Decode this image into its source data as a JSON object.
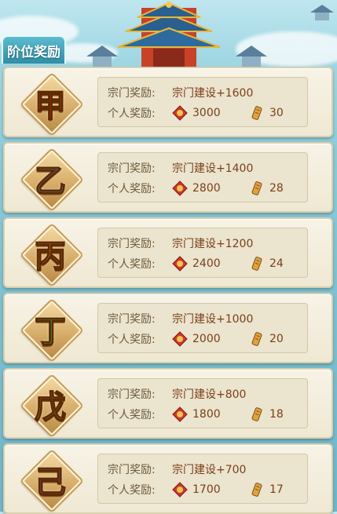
{
  "tab_label": "阶位奖励",
  "colors": {
    "card_bg": "#f2ecda",
    "label": "#6b5a3c",
    "value": "#7a3e18"
  },
  "icons": {
    "currency_1": "gem-coin-icon",
    "currency_2": "scroll-icon"
  },
  "rewards": [
    {
      "rank": "甲",
      "rank_color": "#e8361b",
      "sect_label": "宗门奖励:",
      "sect_value": "宗门建设+1600",
      "personal_label": "个人奖励:",
      "gem": "3000",
      "scroll": "30"
    },
    {
      "rank": "乙",
      "rank_color": "#6d93e0",
      "sect_label": "宗门奖励:",
      "sect_value": "宗门建设+1400",
      "personal_label": "个人奖励:",
      "gem": "2800",
      "scroll": "28"
    },
    {
      "rank": "丙",
      "rank_color": "#f08a2a",
      "sect_label": "宗门奖励:",
      "sect_value": "宗门建设+1200",
      "personal_label": "个人奖励:",
      "gem": "2400",
      "scroll": "24"
    },
    {
      "rank": "丁",
      "rank_color": "#36b24a",
      "sect_label": "宗门奖励:",
      "sect_value": "宗门建设+1000",
      "personal_label": "个人奖励:",
      "gem": "2000",
      "scroll": "20"
    },
    {
      "rank": "戊",
      "rank_color": "#e9b32c",
      "sect_label": "宗门奖励:",
      "sect_value": "宗门建设+800",
      "personal_label": "个人奖励:",
      "gem": "1800",
      "scroll": "18"
    },
    {
      "rank": "己",
      "rank_color": "#b548d8",
      "sect_label": "宗门奖励:",
      "sect_value": "宗门建设+700",
      "personal_label": "个人奖励:",
      "gem": "1700",
      "scroll": "17"
    }
  ]
}
